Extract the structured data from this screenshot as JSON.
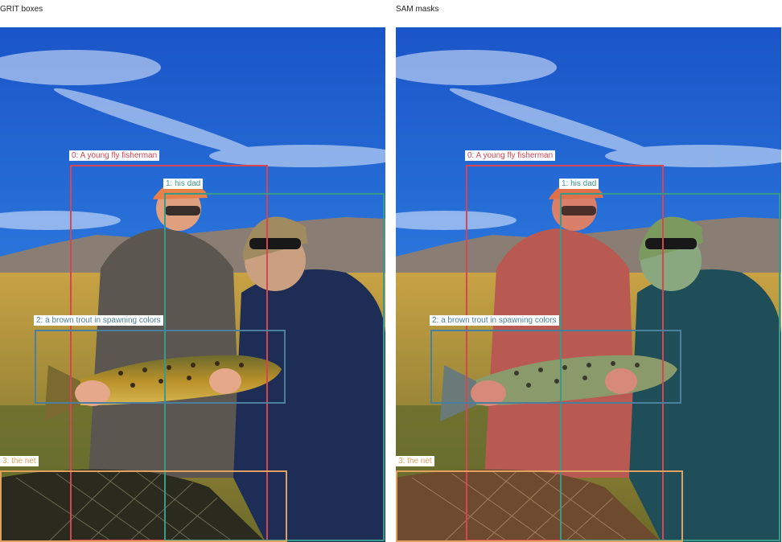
{
  "panels": [
    {
      "title": "GRIT boxes",
      "mode": "boxes"
    },
    {
      "title": "SAM masks",
      "mode": "masks"
    }
  ],
  "detections": [
    {
      "id": 0,
      "label": "0: A young fly fisherman",
      "color": "#d64550"
    },
    {
      "id": 1,
      "label": "1: his dad",
      "color": "#3a9a8a"
    },
    {
      "id": 2,
      "label": "2: a brown trout in spawning colors",
      "color": "#4a7fa0"
    },
    {
      "id": 3,
      "label": "3: the net",
      "color": "#e0a060"
    }
  ]
}
